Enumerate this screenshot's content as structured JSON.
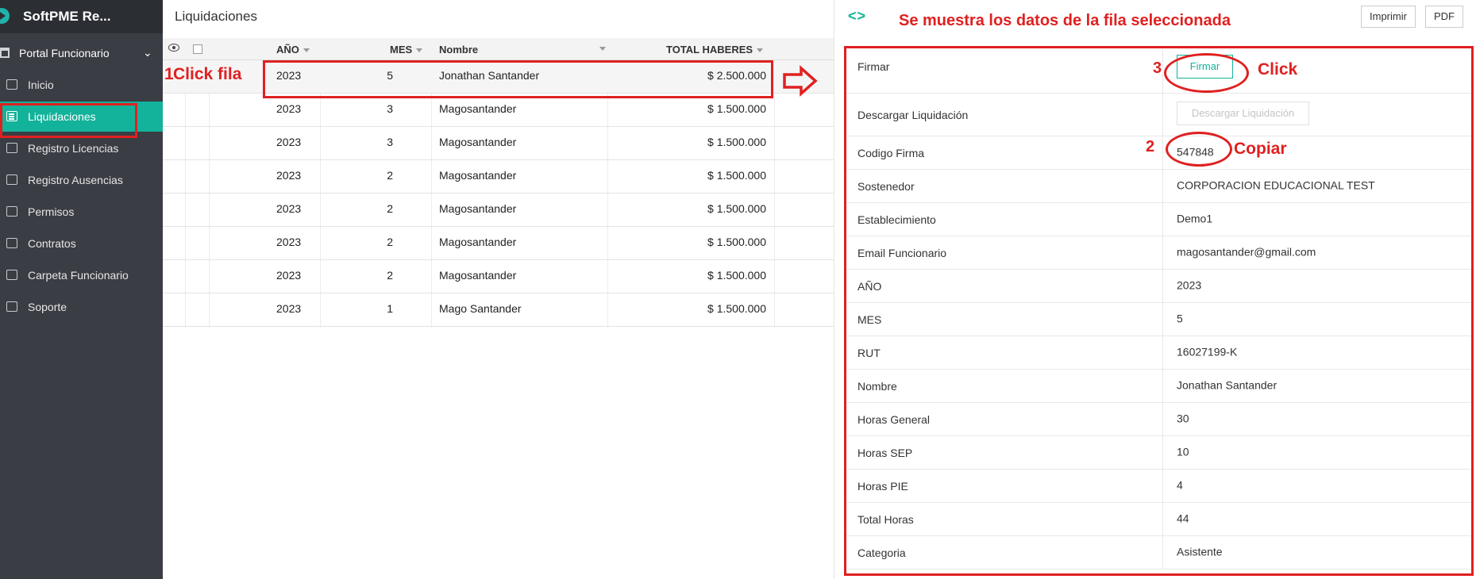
{
  "app": {
    "brand": "SoftPME Re..."
  },
  "sidebar": {
    "section": "Portal Funcionario",
    "items": [
      {
        "label": "Inicio",
        "icon": "home-icon"
      },
      {
        "label": "Liquidaciones",
        "icon": "list-icon",
        "active": true
      },
      {
        "label": "Registro Licencias",
        "icon": "document-icon"
      },
      {
        "label": "Registro Ausencias",
        "icon": "binoculars-icon"
      },
      {
        "label": "Permisos",
        "icon": "inbox-icon"
      },
      {
        "label": "Contratos",
        "icon": "pen-icon"
      },
      {
        "label": "Carpeta Funcionario",
        "icon": "folder-icon"
      },
      {
        "label": "Soporte",
        "icon": "support-icon"
      }
    ]
  },
  "main": {
    "title": "Liquidaciones"
  },
  "grid": {
    "columns": [
      "AÑO",
      "MES",
      "Nombre",
      "TOTAL HABERES"
    ],
    "rows": [
      {
        "anio": "2023",
        "mes": "5",
        "nombre": "Jonathan Santander",
        "total": "$ 2.500.000"
      },
      {
        "anio": "2023",
        "mes": "3",
        "nombre": "Magosantander",
        "total": "$ 1.500.000"
      },
      {
        "anio": "2023",
        "mes": "3",
        "nombre": "Magosantander",
        "total": "$ 1.500.000"
      },
      {
        "anio": "2023",
        "mes": "2",
        "nombre": "Magosantander",
        "total": "$ 1.500.000"
      },
      {
        "anio": "2023",
        "mes": "2",
        "nombre": "Magosantander",
        "total": "$ 1.500.000"
      },
      {
        "anio": "2023",
        "mes": "2",
        "nombre": "Magosantander",
        "total": "$ 1.500.000"
      },
      {
        "anio": "2023",
        "mes": "2",
        "nombre": "Magosantander",
        "total": "$ 1.500.000"
      },
      {
        "anio": "2023",
        "mes": "1",
        "nombre": "Mago Santander",
        "total": "$ 1.500.000"
      }
    ]
  },
  "detail": {
    "toolbar": {
      "print_label": "Imprimir",
      "pdf_label": "PDF"
    },
    "rows": [
      {
        "label": "Firmar",
        "button": "Firmar"
      },
      {
        "label": "Descargar Liquidación",
        "button": "Descargar Liquidación"
      },
      {
        "label": "Codigo Firma",
        "value": "547848"
      },
      {
        "label": "Sostenedor",
        "value": "CORPORACION EDUCACIONAL TEST"
      },
      {
        "label": "Establecimiento",
        "value": "Demo1"
      },
      {
        "label": "Email Funcionario",
        "value": "magosantander@gmail.com"
      },
      {
        "label": "AÑO",
        "value": "2023"
      },
      {
        "label": "MES",
        "value": "5"
      },
      {
        "label": "RUT",
        "value": "16027199-K"
      },
      {
        "label": "Nombre",
        "value": "Jonathan Santander"
      },
      {
        "label": "Horas General",
        "value": "30"
      },
      {
        "label": "Horas SEP",
        "value": "10"
      },
      {
        "label": "Horas PIE",
        "value": "4"
      },
      {
        "label": "Total Horas",
        "value": "44"
      },
      {
        "label": "Categoria",
        "value": "Asistente"
      }
    ]
  },
  "annotations": {
    "step1_num": "1",
    "step1": "Click fila",
    "header": "Se muestra los datos de la fila seleccionada",
    "step2_num": "2",
    "step2": "Copiar",
    "step3_num": "3",
    "step3": "Click"
  },
  "colors": {
    "accent": "#13b29a",
    "sidebar": "#3a3d44",
    "brand_bar": "#2b2e33",
    "annotation": "#e02020"
  }
}
